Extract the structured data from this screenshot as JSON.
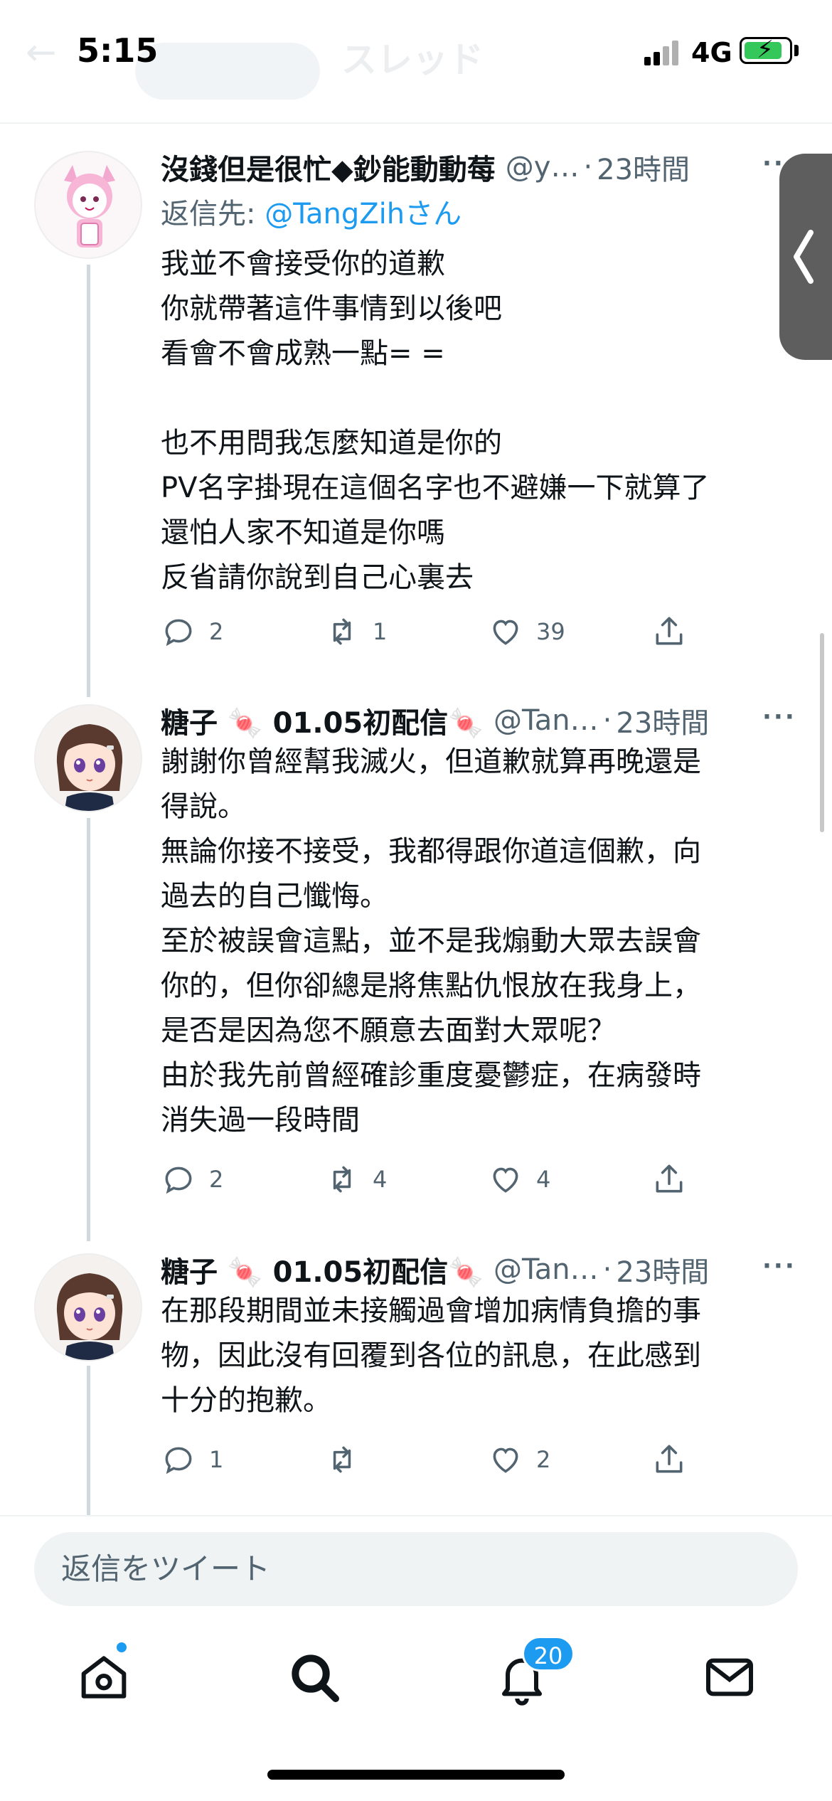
{
  "status_bar": {
    "time": "5:15",
    "network": "4G",
    "faded_title": "スレッド"
  },
  "tweets": [
    {
      "display_name": "沒錢但是很忙◆鈔能動動莓",
      "handle": "@y…",
      "time_ago": "23時間",
      "reply_label": "返信先: ",
      "reply_to": "@TangZihさん",
      "text": "我並不會接受你的道歉\n你就帶著這件事情到以後吧\n看會不會成熟一點= =\n\n也不用問我怎麼知道是你的\nPV名字掛現在這個名字也不避嫌一下就算了\n還怕人家不知道是你嗎\n反省請你說到自己心裏去",
      "replies": "2",
      "retweets": "1",
      "likes": "39"
    },
    {
      "display_name": "糖子 🍬 01.05初配信🍬",
      "handle": "@Tan…",
      "time_ago": "23時間",
      "text": "謝謝你曾經幫我滅火，但道歉就算再晚還是\n得說。\n無論你接不接受，我都得跟你道這個歉，向\n過去的自己懺悔。\n至於被誤會這點，並不是我煽動大眾去誤會\n你的，但你卻總是將焦點仇恨放在我身上，\n是否是因為您不願意去面對大眾呢？\n由於我先前曾經確診重度憂鬱症，在病發時\n消失過一段時間",
      "replies": "2",
      "retweets": "4",
      "likes": "4"
    },
    {
      "display_name": "糖子 🍬 01.05初配信🍬",
      "handle": "@Tan…",
      "time_ago": "23時間",
      "text": "在那段期間並未接觸過會增加病情負擔的事\n物，因此沒有回覆到各位的訊息，在此感到\n十分的抱歉。",
      "replies": "1",
      "retweets": "",
      "likes": "2"
    }
  ],
  "reply_bar": {
    "placeholder": "返信をツイート"
  },
  "tab_bar": {
    "items": [
      "home-icon",
      "search-icon",
      "bell-icon",
      "mail-icon"
    ],
    "notification_count": "20"
  },
  "colors": {
    "accent": "#1d9bf0",
    "secondary_text": "#536471",
    "text": "#0f1419"
  }
}
